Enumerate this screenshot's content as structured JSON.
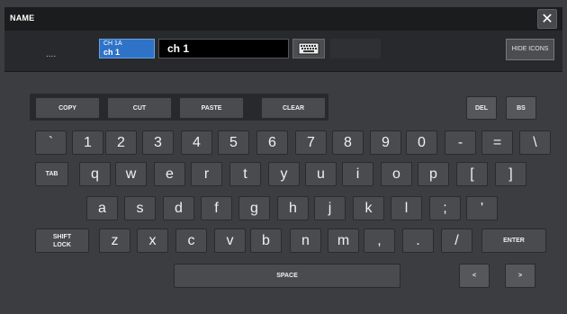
{
  "title": "NAME",
  "close_label": "✕",
  "name_bar": {
    "dots": "....",
    "chip_line1": "CH 1A",
    "chip_line2": "ch 1",
    "name_value": "ch 1",
    "hide_icons_label": "HIDE ICONS"
  },
  "edit_keys": {
    "copy": "COPY",
    "cut": "CUT",
    "paste": "PASTE",
    "clear": "CLEAR",
    "del": "DEL",
    "bs": "BS"
  },
  "row1": [
    "`",
    "1",
    "2",
    "3",
    "4",
    "5",
    "6",
    "7",
    "8",
    "9",
    "0",
    "-",
    "=",
    "\\"
  ],
  "tab_label": "TAB",
  "row2": [
    "q",
    "w",
    "e",
    "r",
    "t",
    "y",
    "u",
    "i",
    "o",
    "p",
    "[",
    "]"
  ],
  "row3": [
    "a",
    "s",
    "d",
    "f",
    "g",
    "h",
    "j",
    "k",
    "l",
    ";",
    "'"
  ],
  "shift_lock_label": "SHIFT\nLOCK",
  "row4": [
    "z",
    "x",
    "c",
    "v",
    "b",
    "n",
    "m",
    ",",
    ".",
    "/"
  ],
  "enter_label": "ENTER",
  "space_label": "SPACE",
  "left_label": "<",
  "right_label": ">",
  "icon_names": {
    "close": "close-icon",
    "keyboard": "keyboard-icon"
  }
}
